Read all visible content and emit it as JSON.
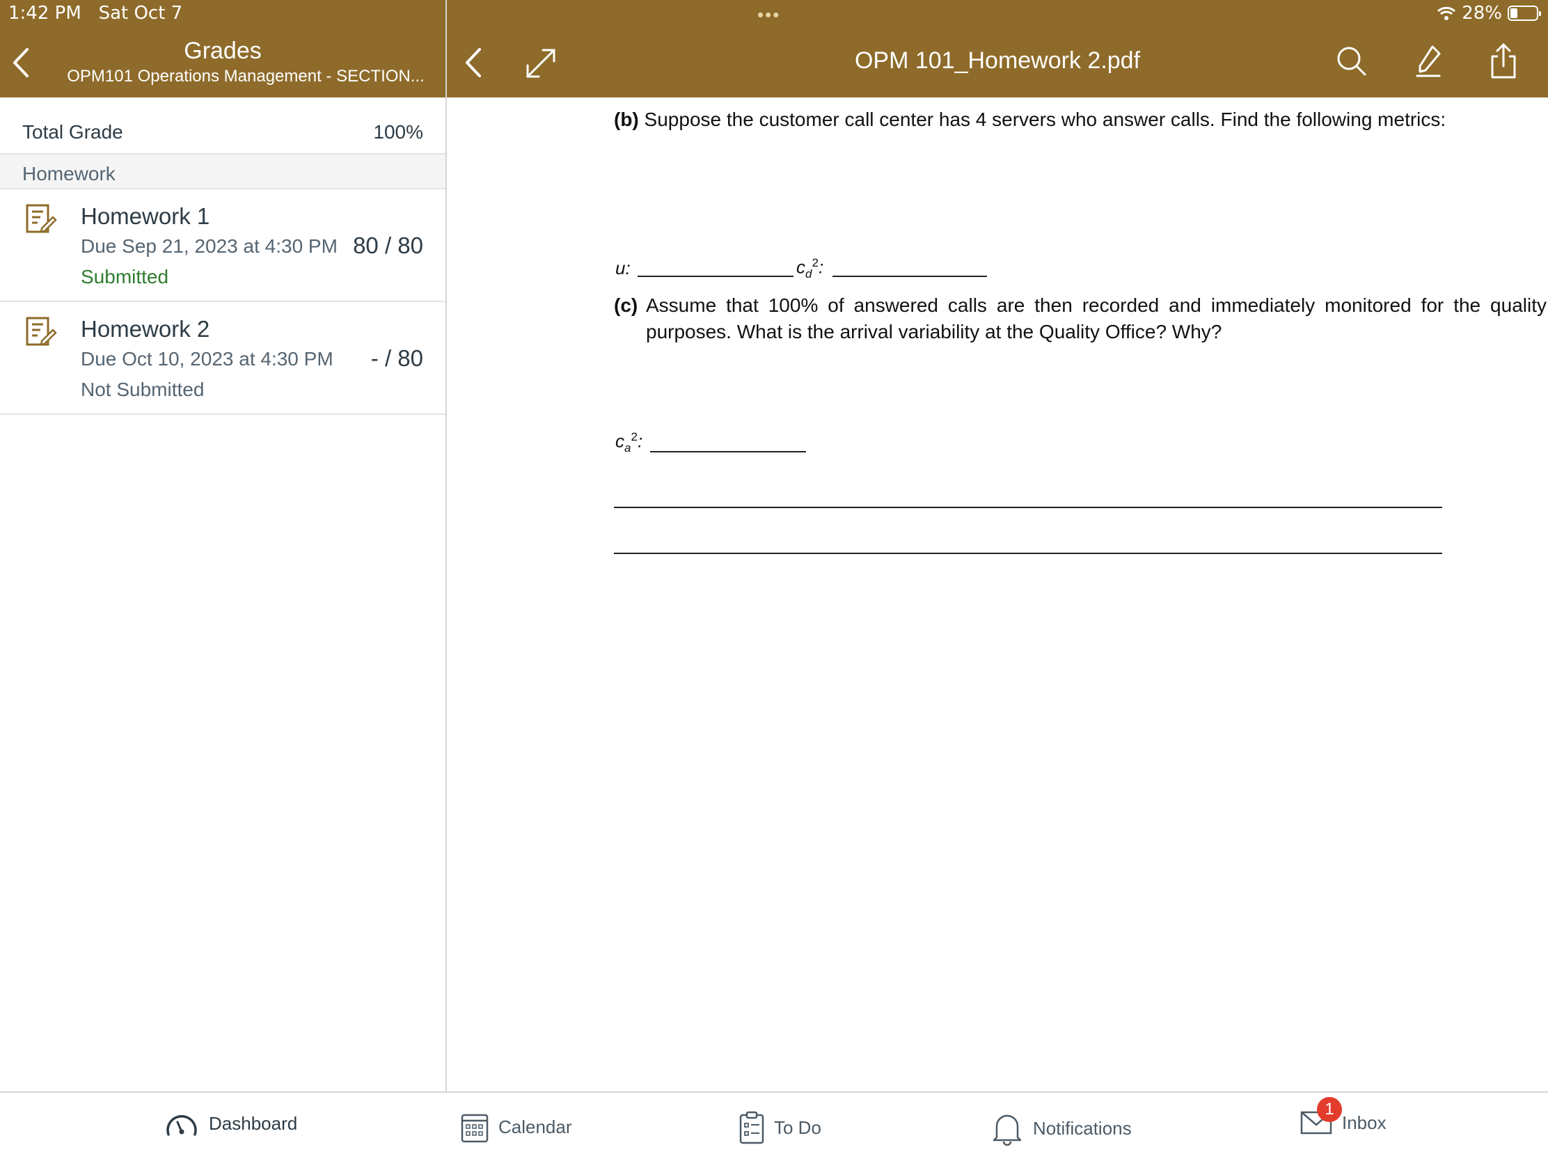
{
  "status_bar": {
    "time": "1:42 PM",
    "date": "Sat Oct 7",
    "dots": "•••",
    "battery": "28%"
  },
  "left_header": {
    "title": "Grades",
    "subtitle": "OPM101 Operations Management - SECTION..."
  },
  "doc_header": {
    "title": "OPM 101_Homework 2.pdf"
  },
  "grades": {
    "total_label": "Total Grade",
    "total_value": "100%",
    "group": "Homework",
    "assignments": [
      {
        "name": "Homework 1",
        "due": "Due Sep 21, 2023 at 4:30 PM",
        "status": "Submitted",
        "score": "80 / 80"
      },
      {
        "name": "Homework 2",
        "due": "Due Oct 10, 2023 at 4:30 PM",
        "status": "Not Submitted",
        "score": "- / 80"
      }
    ]
  },
  "document": {
    "part_b": {
      "label": "(b)",
      "text": "Suppose the customer call center has 4 servers who answer calls. Find the following metrics:"
    },
    "metric_u": "u:",
    "metric_cd": {
      "base": "c",
      "sub": "d",
      "sup": "2",
      "colon": ":"
    },
    "part_c": {
      "label": "(c)",
      "text": "Assume that 100% of answered calls are then recorded and immediately monitored for the quality purposes. What is the arrival variability at the Quality Office? Why?"
    },
    "metric_ca": {
      "base": "c",
      "sub": "a",
      "sup": "2",
      "colon": ":"
    }
  },
  "tab_bar": {
    "tabs": [
      {
        "label": "Dashboard",
        "icon": "dashboard-icon"
      },
      {
        "label": "Calendar",
        "icon": "calendar-icon"
      },
      {
        "label": "To Do",
        "icon": "todo-icon"
      },
      {
        "label": "Notifications",
        "icon": "bell-icon"
      },
      {
        "label": "Inbox",
        "icon": "mail-icon"
      }
    ],
    "inbox_badge": "1"
  },
  "colors": {
    "brand": "#8e6b2a",
    "submitted": "#2e7d2e",
    "badge": "#e23c2c"
  }
}
